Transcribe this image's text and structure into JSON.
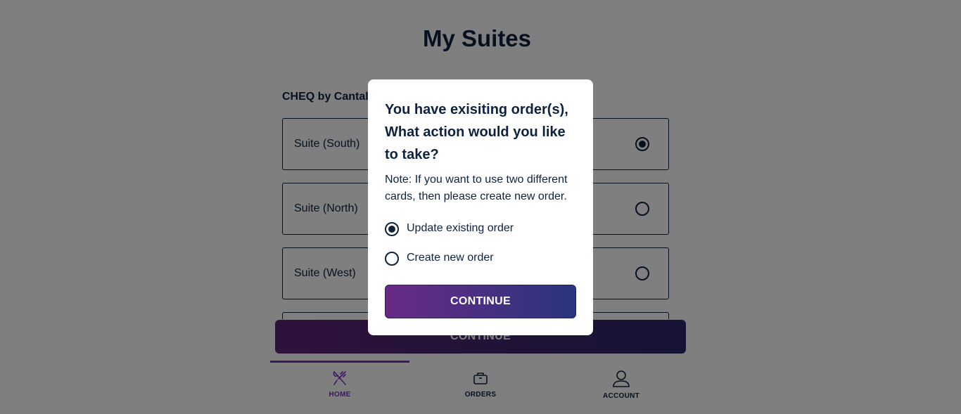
{
  "page": {
    "title": "My Suites",
    "venue": "CHEQ by Cantalo",
    "suites": [
      {
        "name": "Suite (South)",
        "selected": true
      },
      {
        "name": "Suite (North)",
        "selected": false
      },
      {
        "name": "Suite (West)",
        "selected": false
      }
    ],
    "continue_label": "CONTINUE"
  },
  "modal": {
    "title": "You have exisiting order(s), What action would you like to take?",
    "note": "Note: If you want to use two different cards, then please create new order.",
    "options": [
      {
        "label": "Update existing order",
        "selected": true
      },
      {
        "label": "Create new order",
        "selected": false
      }
    ],
    "continue_label": "CONTINUE"
  },
  "nav": {
    "items": [
      {
        "label": "HOME",
        "icon": "fork-knife-icon",
        "active": true
      },
      {
        "label": "ORDERS",
        "icon": "bag-icon",
        "active": false
      },
      {
        "label": "ACCOUNT",
        "icon": "user-icon",
        "active": false
      }
    ]
  },
  "colors": {
    "navy": "#0d2240",
    "accent_purple": "#7b2fbf",
    "button_gradient_start": "#6a2a86",
    "button_gradient_end": "#29357e"
  }
}
